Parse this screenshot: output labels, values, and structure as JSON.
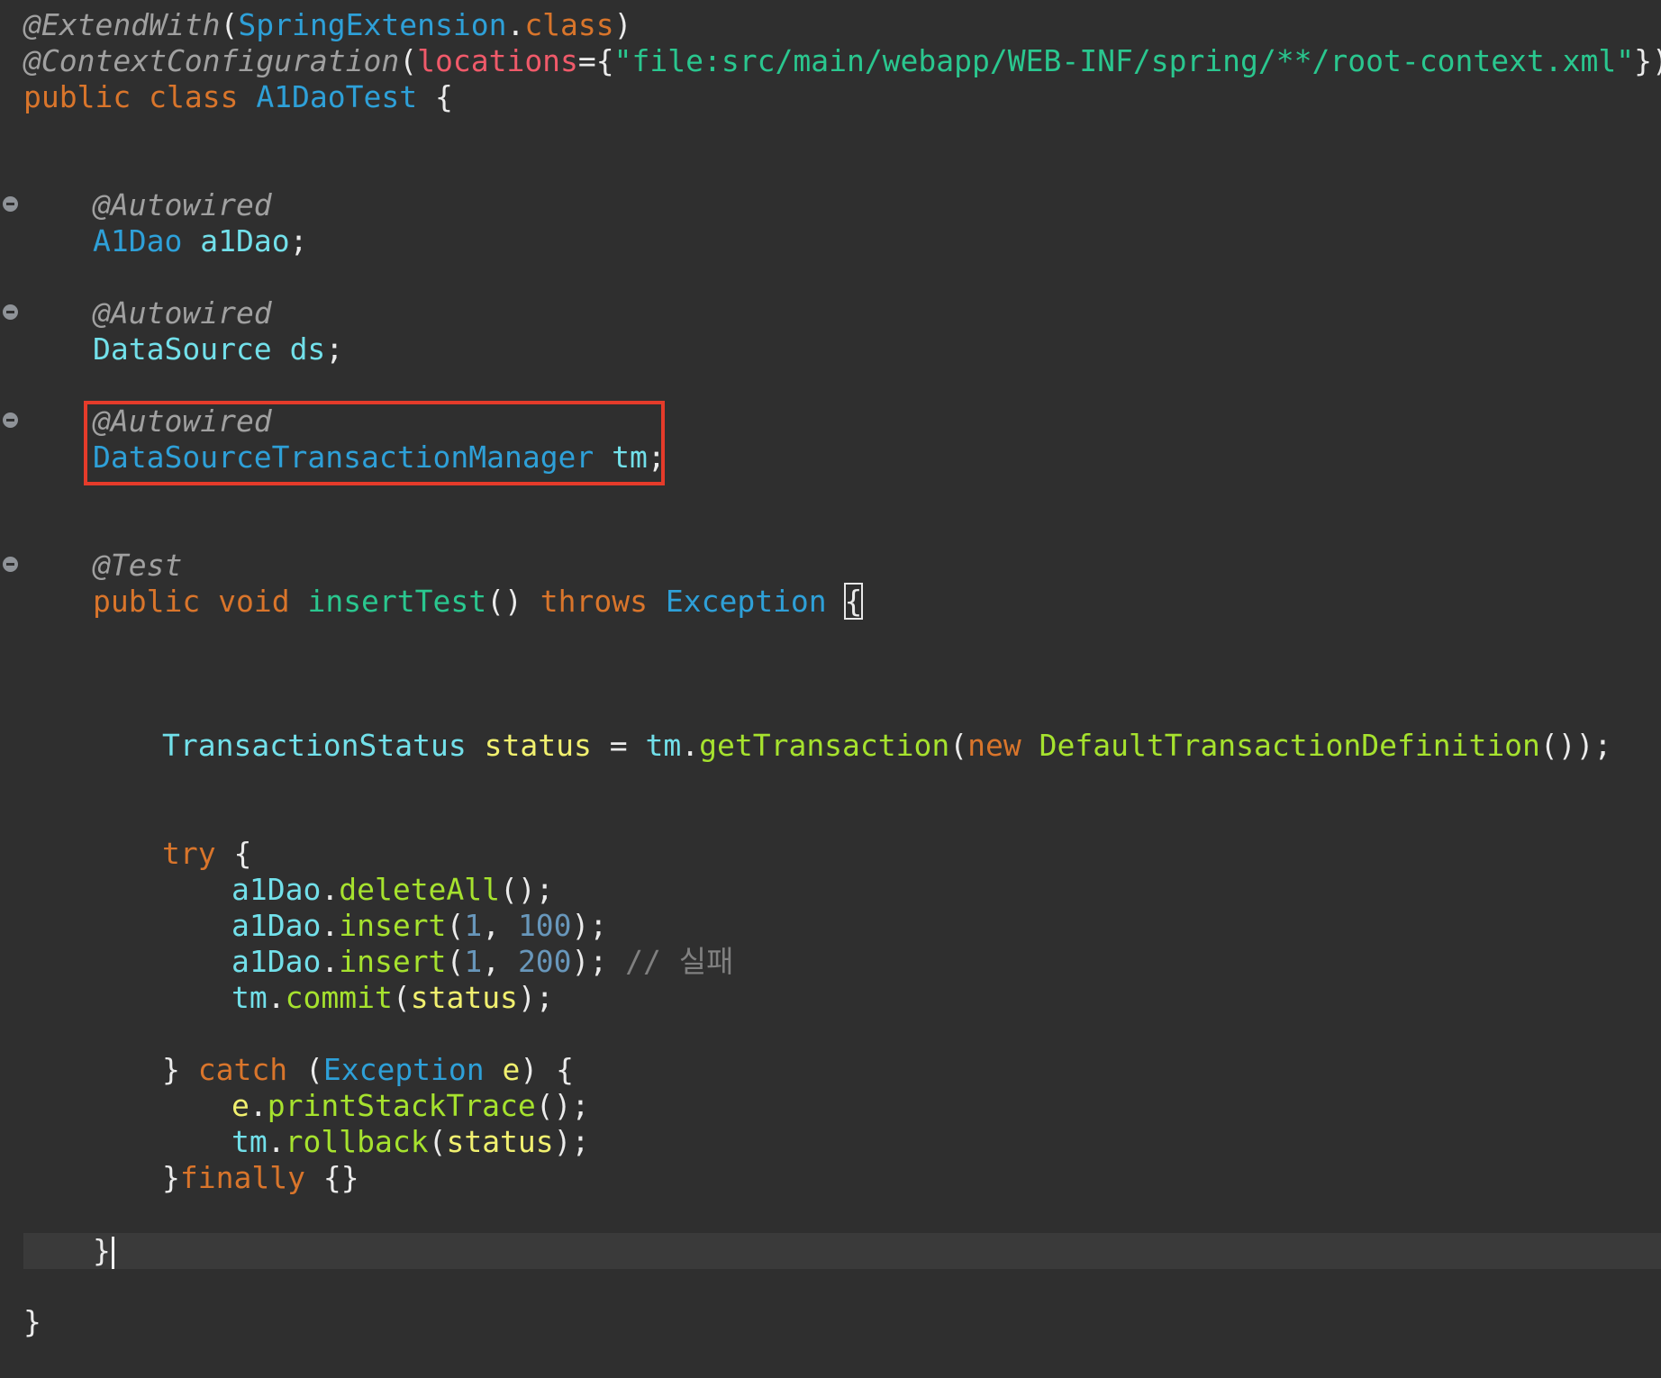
{
  "editor": {
    "language": "java",
    "theme_colors": {
      "background": "#2f2f2f",
      "keyword": "#d9752b",
      "type": "#2ea0d8",
      "field": "#72e0ea",
      "method": "#a6e22e",
      "variable": "#f1f06f",
      "string": "#2ac78f",
      "annotation": "#a0a0a0",
      "number": "#6897bb",
      "highlight_box": "#e53b2a"
    },
    "code": {
      "ann_extend": "@ExtendWith",
      "extend_arg": "SpringExtension",
      "kw_class_literal": "class",
      "ann_context": "@ContextConfiguration",
      "attr_locations": "locations",
      "str_location": "\"file:src/main/webapp/WEB-INF/spring/**/root-context.xml\"",
      "kw_public": "public",
      "kw_class": "class",
      "class_name": "A1DaoTest",
      "ann_autowired": "@Autowired",
      "type_a1dao": "A1Dao",
      "field_a1dao": "a1Dao",
      "type_datasource": "DataSource",
      "field_ds": "ds",
      "type_tm": "DataSourceTransactionManager",
      "field_tm": "tm",
      "ann_test": "@Test",
      "kw_void": "void",
      "method_insert_test": "insertTest",
      "kw_throws": "throws",
      "type_exception": "Exception",
      "type_tx_status": "TransactionStatus",
      "var_status": "status",
      "method_get_tx": "getTransaction",
      "kw_new": "new",
      "ctor_default_def": "DefaultTransactionDefinition",
      "kw_try": "try",
      "method_delete_all": "deleteAll",
      "method_insert": "insert",
      "num_1": "1",
      "num_100": "100",
      "num_200": "200",
      "comment_fail": "// 실패",
      "method_commit": "commit",
      "kw_catch": "catch",
      "var_e": "e",
      "method_print_stack": "printStackTrace",
      "method_rollback": "rollback",
      "kw_finally": "finally"
    }
  }
}
